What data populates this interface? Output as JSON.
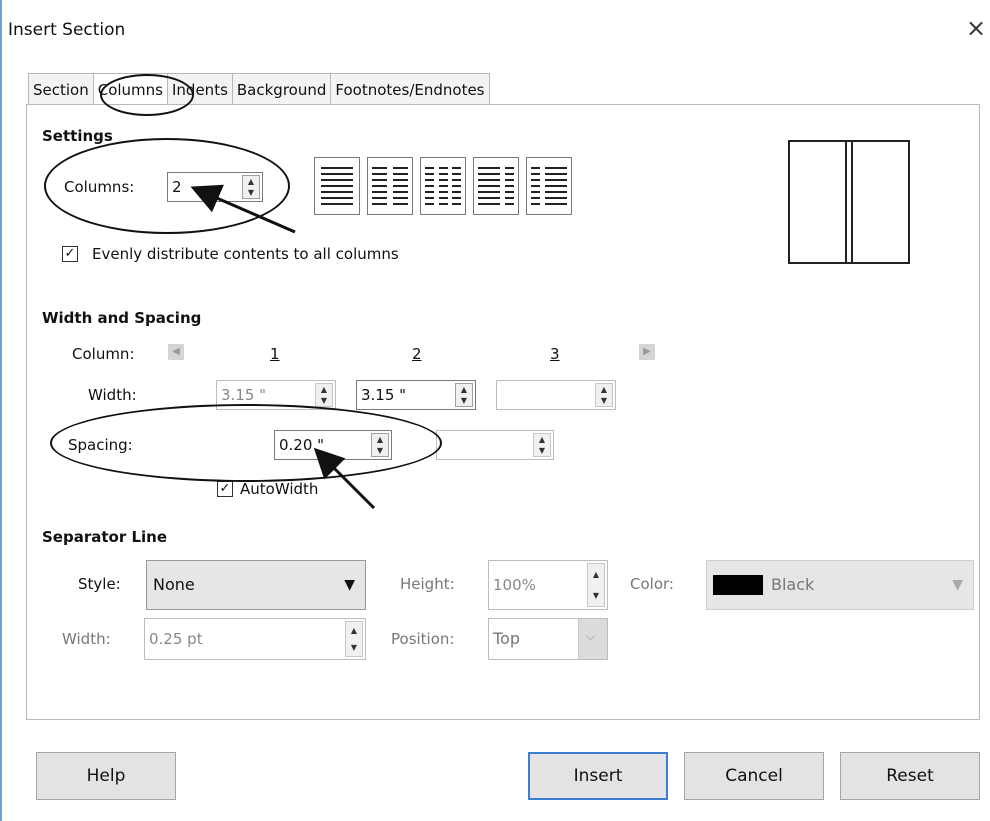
{
  "window": {
    "title": "Insert Section",
    "close_glyph": "×"
  },
  "tabs": [
    "Section",
    "Columns",
    "Indents",
    "Background",
    "Footnotes/Endnotes"
  ],
  "settings": {
    "heading": "Settings",
    "columns_label": "Columns:",
    "columns_value": "2",
    "evenly_label": "Evenly distribute contents to all columns",
    "evenly_checked": true
  },
  "width_spacing": {
    "heading": "Width and Spacing",
    "column_label": "Column:",
    "column_numbers": [
      "1",
      "2",
      "3"
    ],
    "width_label": "Width:",
    "width_values": [
      "3.15 \"",
      "3.15 \"",
      ""
    ],
    "spacing_label": "Spacing:",
    "spacing_values": [
      "0.20 \"",
      ""
    ],
    "autowidth_label": "AutoWidth",
    "autowidth_checked": true
  },
  "separator": {
    "heading": "Separator Line",
    "style_label": "Style:",
    "style_value": "None",
    "height_label": "Height:",
    "height_value": "100%",
    "color_label": "Color:",
    "color_value": "Black",
    "color_swatch": "#000000",
    "width_label": "Width:",
    "width_value": "0.25 pt",
    "position_label": "Position:",
    "position_value": "Top"
  },
  "buttons": {
    "help": "Help",
    "insert": "Insert",
    "cancel": "Cancel",
    "reset": "Reset"
  },
  "colors": {
    "accent": "#3c7fd0",
    "disabled_text": "#777777"
  }
}
